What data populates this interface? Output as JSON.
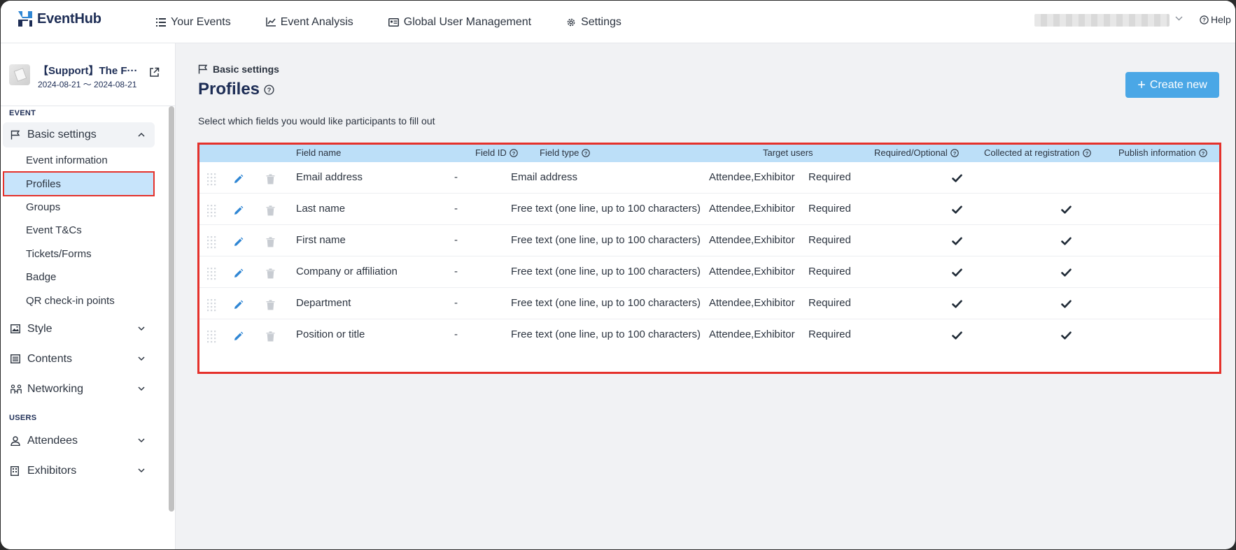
{
  "app": {
    "name": "EventHub",
    "help_label": "Help"
  },
  "topnav": [
    {
      "label": "Your Events",
      "icon": "list-icon"
    },
    {
      "label": "Event Analysis",
      "icon": "chart-icon"
    },
    {
      "label": "Global User Management",
      "icon": "id-card-icon"
    },
    {
      "label": "Settings",
      "icon": "gear-icon"
    }
  ],
  "event": {
    "name": "【Support】The F···",
    "dates": "2024-08-21 ～ 2024-08-21"
  },
  "sidebar": {
    "sections": {
      "event": "EVENT",
      "users": "USERS"
    },
    "basic_settings": "Basic settings",
    "sub_items": [
      "Event information",
      "Profiles",
      "Groups",
      "Event T&Cs",
      "Tickets/Forms",
      "Badge",
      "QR check-in points"
    ],
    "style": "Style",
    "contents": "Contents",
    "networking": "Networking",
    "attendees": "Attendees",
    "exhibitors": "Exhibitors"
  },
  "main": {
    "breadcrumb": "Basic settings",
    "title": "Profiles",
    "create_label": "Create new",
    "description": "Select which fields you would like participants to fill out"
  },
  "table": {
    "headers": {
      "field_name": "Field name",
      "field_id": "Field ID",
      "field_type": "Field type",
      "target_users": "Target users",
      "required": "Required/Optional",
      "collected": "Collected at registration",
      "publish": "Publish information"
    },
    "rows": [
      {
        "field_name": "Email address",
        "field_id": "-",
        "field_type": "Email address",
        "target_users": "Attendee,Exhibitor",
        "required": "Required",
        "collected": true,
        "publish": false
      },
      {
        "field_name": "Last name",
        "field_id": "-",
        "field_type": "Free text (one line, up to 100 characters)",
        "target_users": "Attendee,Exhibitor",
        "required": "Required",
        "collected": true,
        "publish": true
      },
      {
        "field_name": "First name",
        "field_id": "-",
        "field_type": "Free text (one line, up to 100 characters)",
        "target_users": "Attendee,Exhibitor",
        "required": "Required",
        "collected": true,
        "publish": true
      },
      {
        "field_name": "Company or affiliation",
        "field_id": "-",
        "field_type": "Free text (one line, up to 100 characters)",
        "target_users": "Attendee,Exhibitor",
        "required": "Required",
        "collected": true,
        "publish": true
      },
      {
        "field_name": "Department",
        "field_id": "-",
        "field_type": "Free text (one line, up to 100 characters)",
        "target_users": "Attendee,Exhibitor",
        "required": "Required",
        "collected": true,
        "publish": true
      },
      {
        "field_name": "Position or title",
        "field_id": "-",
        "field_type": "Free text (one line, up to 100 characters)",
        "target_users": "Attendee,Exhibitor",
        "required": "Required",
        "collected": true,
        "publish": true
      }
    ]
  },
  "colors": {
    "accent": "#4aa7e6",
    "highlight": "#e5312b",
    "header_bg": "#bcdff8",
    "active_bg": "#c7e4fb"
  }
}
